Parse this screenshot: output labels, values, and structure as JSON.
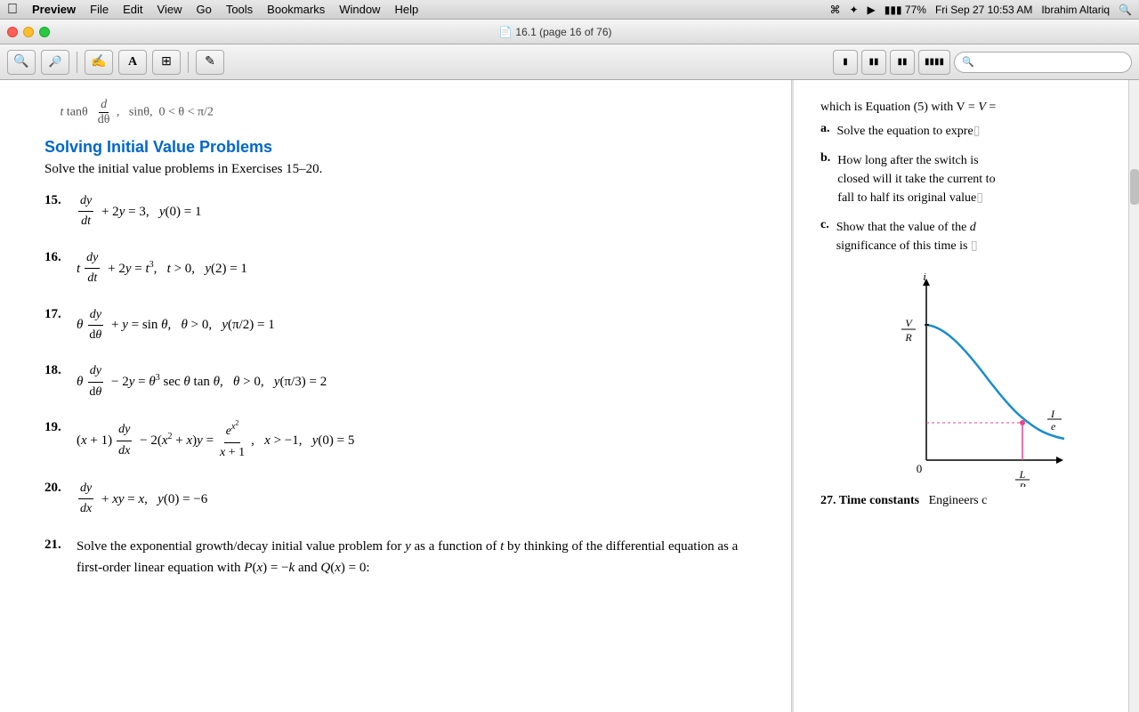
{
  "menubar": {
    "apple": "⌘",
    "items": [
      "Preview",
      "File",
      "Edit",
      "View",
      "Go",
      "Tools",
      "Bookmarks",
      "Window",
      "Help"
    ],
    "right": {
      "battery": "77%",
      "datetime": "Fri Sep 27  10:53 AM",
      "user": "Ibrahim Altariq"
    }
  },
  "titlebar": {
    "title": "16.1 (page 16 of 76)"
  },
  "toolbar": {
    "buttons": [
      "🔍",
      "🔎",
      "✋",
      "A",
      "⊞",
      "✏"
    ]
  },
  "left_page": {
    "top_eq": "tan θ  dθ,   sin θ,  0 < θ < π/2",
    "section_heading": "Solving Initial Value Problems",
    "intro": "Solve the initial value problems in Exercises 15–20.",
    "problems": [
      {
        "num": "15.",
        "eq": "dy/dt + 2y = 3,   y(0) = 1"
      },
      {
        "num": "16.",
        "eq": "t dy/dt + 2y = t³,   t > 0,   y(2) = 1"
      },
      {
        "num": "17.",
        "eq": "θ dy/dθ + y = sin θ,   θ > 0,   y(π/2) = 1"
      },
      {
        "num": "18.",
        "eq": "θ dy/dθ − 2y = θ³ sec θ tan θ,   θ > 0,   y(π/3) = 2"
      },
      {
        "num": "19.",
        "eq": "(x + 1) dy/dx − 2(x² + x)y = eˣ²/(x + 1),   x > −1,   y(0) = 5"
      },
      {
        "num": "20.",
        "eq": "dy/dx + xy = x,   y(0) = −6"
      },
      {
        "num": "21.",
        "eq": "Solve the exponential growth/decay initial value problem for y as a function of t by thinking of the differential equation as a first-order linear equation with P(x) = −k and Q(x) = 0:"
      }
    ]
  },
  "right_page": {
    "top_text": "which is Equation (5) with V =",
    "items": [
      {
        "letter": "a.",
        "text": "Solve the equation to expre"
      },
      {
        "letter": "b.",
        "text": "How long after the switch is closed will it take the current to fall to half its original value"
      },
      {
        "letter": "c.",
        "text": "Show that the value of the significance of this time is"
      }
    ],
    "chart": {
      "x_label": "L/R",
      "y_label": "V/R",
      "i_label": "i",
      "ie_label": "I/e",
      "origin": "0"
    },
    "bottom_text": "27. Time constants   Engineers c"
  }
}
